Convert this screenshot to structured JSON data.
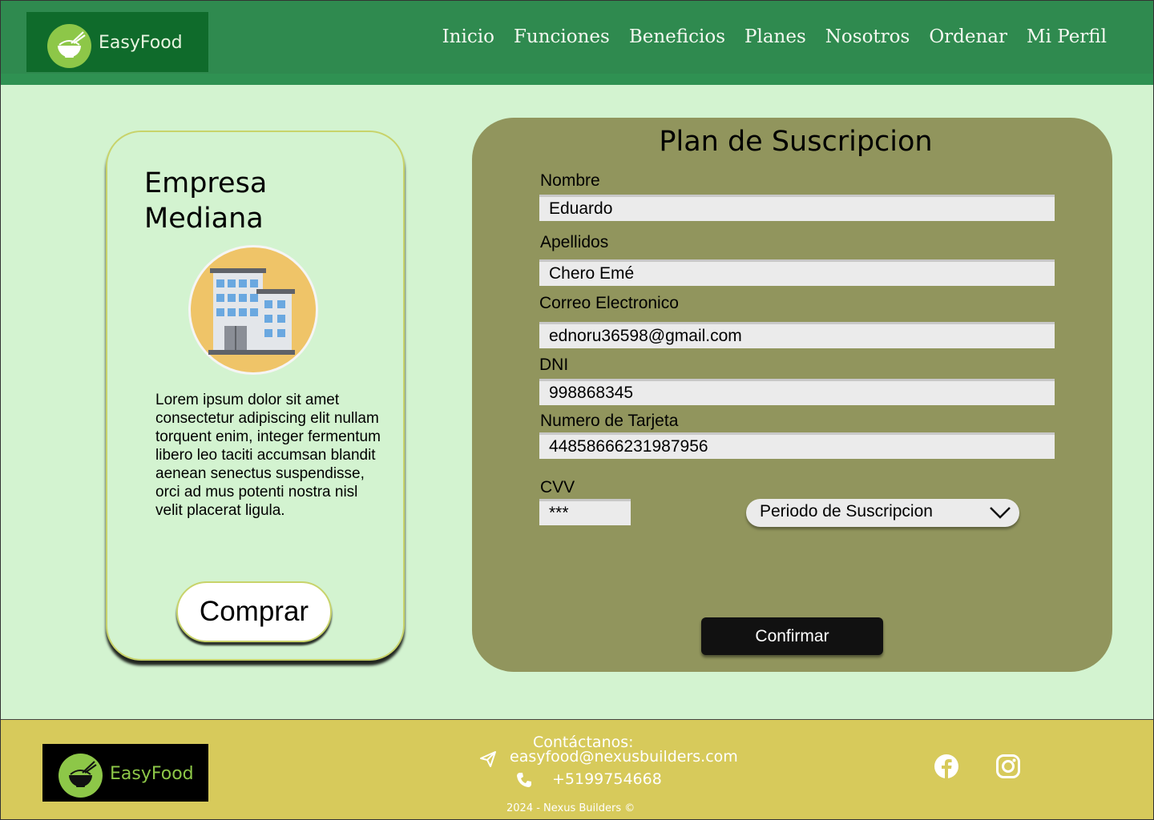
{
  "header": {
    "brand": "EasyFood",
    "nav": [
      "Inicio",
      "Funciones",
      "Beneficios",
      "Planes",
      "Nosotros",
      "Ordenar",
      "Mi Perfil"
    ]
  },
  "plan_card": {
    "title": "Empresa Mediana",
    "description": "Lorem ipsum dolor sit amet consectetur adipiscing elit nullam torquent enim, integer fermentum libero leo taciti accumsan blandit aenean senectus suspendisse, orci ad mus potenti nostra nisl velit placerat ligula.",
    "buy_label": "Comprar",
    "icon": "building-icon"
  },
  "form": {
    "title": "Plan de Suscripcion",
    "fields": {
      "nombre": {
        "label": "Nombre",
        "value": "Eduardo"
      },
      "apellidos": {
        "label": "Apellidos",
        "value": "Chero Emé"
      },
      "correo": {
        "label": "Correo Electronico",
        "value": "ednoru36598@gmail.com"
      },
      "dni": {
        "label": "DNI",
        "value": "998868345"
      },
      "tarjeta": {
        "label": "Numero de Tarjeta",
        "value": "44858666231987956"
      },
      "cvv": {
        "label": "CVV",
        "value": "***"
      }
    },
    "period_select": "Periodo de Suscripcion",
    "confirm_label": "Confirmar"
  },
  "footer": {
    "brand": "EasyFood",
    "contact_title": "Contáctanos:",
    "email": "easyfood@nexusbuilders.com",
    "phone": "+5199754668",
    "copyright": "2024 - Nexus Builders ©",
    "social": [
      "facebook-icon",
      "instagram-icon"
    ]
  },
  "colors": {
    "header_green": "#2f8a4f",
    "page_bg": "#d3f3d0",
    "form_panel": "#91955d",
    "footer_yellow": "#d7ca5b",
    "logo_green": "#8dc748"
  }
}
